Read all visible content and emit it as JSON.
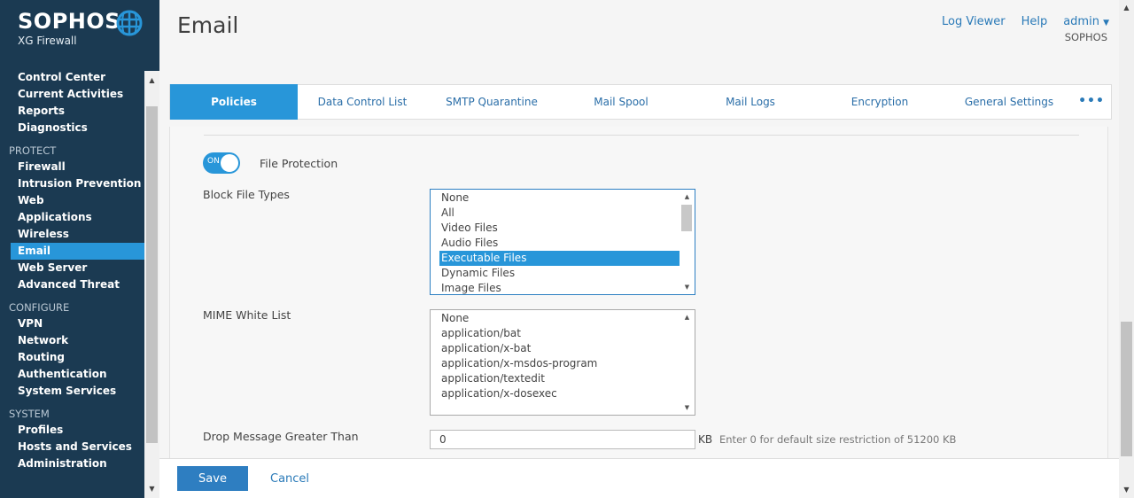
{
  "brand": {
    "name": "SOPHOS",
    "product": "XG Firewall",
    "color": "#1b3a52",
    "accent": "#2896d9"
  },
  "nav": {
    "top": [
      "Control Center",
      "Current Activities",
      "Reports",
      "Diagnostics"
    ],
    "protect": {
      "title": "PROTECT",
      "items": [
        "Firewall",
        "Intrusion Prevention",
        "Web",
        "Applications",
        "Wireless",
        "Email",
        "Web Server",
        "Advanced Threat"
      ],
      "active": "Email"
    },
    "configure": {
      "title": "CONFIGURE",
      "items": [
        "VPN",
        "Network",
        "Routing",
        "Authentication",
        "System Services"
      ]
    },
    "system": {
      "title": "SYSTEM",
      "items": [
        "Profiles",
        "Hosts and Services",
        "Administration"
      ]
    }
  },
  "header": {
    "title": "Email",
    "links": {
      "log_viewer": "Log Viewer",
      "help": "Help",
      "user": "admin"
    },
    "org": "SOPHOS"
  },
  "tabs": [
    "Policies",
    "Data Control List",
    "SMTP Quarantine",
    "Mail Spool",
    "Mail Logs",
    "Encryption",
    "General Settings"
  ],
  "active_tab": "Policies",
  "form": {
    "file_protection": {
      "toggle": "ON",
      "label": "File Protection"
    },
    "block_file_types": {
      "label": "Block File Types",
      "options": [
        "None",
        "All",
        "Video Files",
        "Audio Files",
        "Executable Files",
        "Dynamic Files",
        "Image Files"
      ],
      "selected": "Executable Files"
    },
    "mime_white_list": {
      "label": "MIME White List",
      "options": [
        "None",
        "application/bat",
        "application/x-bat",
        "application/x-msdos-program",
        "application/textedit",
        "application/x-dosexec"
      ]
    },
    "drop_message": {
      "label": "Drop Message Greater Than",
      "value": "0",
      "unit": "KB",
      "hint": "Enter 0 for default size restriction of 51200 KB"
    }
  },
  "footer": {
    "save": "Save",
    "cancel": "Cancel"
  }
}
